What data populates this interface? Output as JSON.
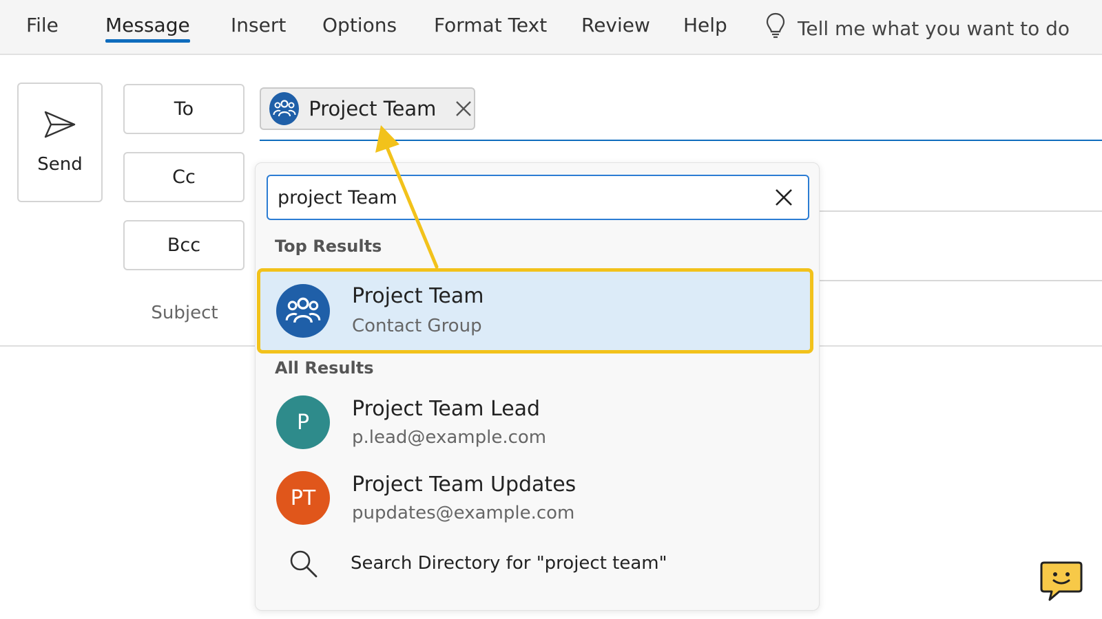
{
  "ribbon": {
    "tabs": [
      {
        "label": "File"
      },
      {
        "label": "Message",
        "active": true
      },
      {
        "label": "Insert"
      },
      {
        "label": "Options"
      },
      {
        "label": "Format Text"
      },
      {
        "label": "Review"
      },
      {
        "label": "Help"
      }
    ],
    "tell_me": "Tell me what you want to do"
  },
  "compose": {
    "send_label": "Send",
    "to_label": "To",
    "cc_label": "Cc",
    "bcc_label": "Bcc",
    "subject_label": "Subject",
    "to_recipient": "Project Team"
  },
  "suggestions": {
    "query": "project Team",
    "top_results_label": "Top Results",
    "top_result": {
      "name": "Project Team",
      "subtitle": "Contact Group"
    },
    "all_results_label": "All Results",
    "all_results": [
      {
        "initials": "P",
        "name": "Project Team Lead",
        "email": "p.lead@example.com",
        "color": "#2e8b8b"
      },
      {
        "initials": "PT",
        "name": "Project Team Updates",
        "email": "pupdates@example.com",
        "color": "#e0561b"
      }
    ],
    "search_directory": "Search Directory for \"project team\""
  },
  "colors": {
    "accent": "#0f6cbd",
    "highlight_border": "#f2c21b",
    "highlight_fill": "#dcebf8",
    "group_avatar": "#1f5fa8"
  }
}
